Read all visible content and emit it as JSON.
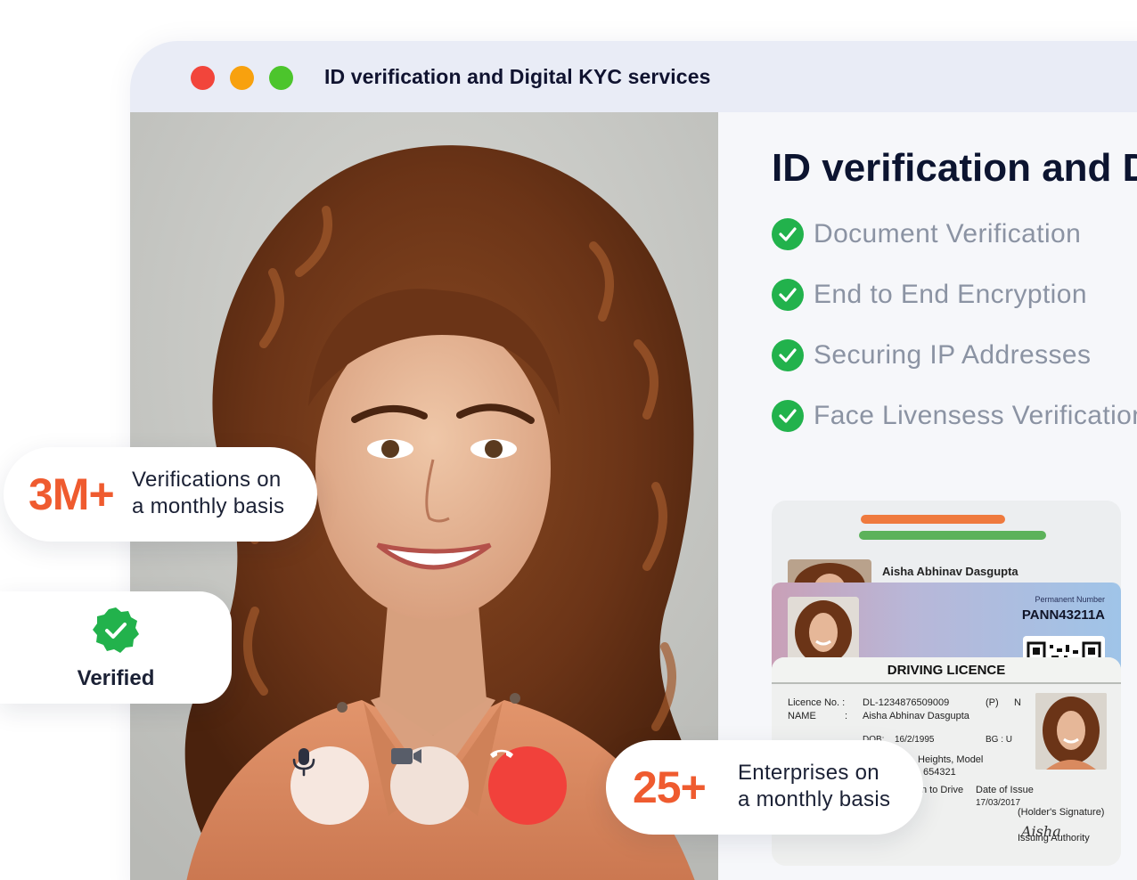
{
  "window": {
    "title": "ID verification and Digital KYC services",
    "controls": [
      "close",
      "minimize",
      "maximize"
    ]
  },
  "call_controls": {
    "mic_icon": "microphone-icon",
    "camera_icon": "video-camera-icon",
    "end_icon": "phone-hangup-icon"
  },
  "panel": {
    "heading": "ID verification and Digital KYC services",
    "features": [
      {
        "label": "Document Verification"
      },
      {
        "label": "End to End Encryption"
      },
      {
        "label": "Securing IP Addresses"
      },
      {
        "label": "Face Livensess Verification"
      }
    ]
  },
  "id_cards": {
    "top_name": "Aisha Abhinav Dasgupta",
    "pan": {
      "perm_label": "Permanent Number",
      "number": "PANN43211A"
    },
    "dl": {
      "title": "DRIVING LICENCE",
      "licence_label": "Licence No. :",
      "licence_no": "DL-1234876509009",
      "p_label": "(P)",
      "n_label": "N",
      "name_label": "NAME",
      "name_sep": ":",
      "name": "Aisha Abhinav Dasgupta",
      "dob_label": "DOB:",
      "dob": "16/2/1995",
      "bg_label": "BG : U",
      "address_1": "Heights, Model",
      "address_2": "654321",
      "drive_label": "n to Drive",
      "issue_label": "Date of Issue",
      "issue_date": "17/03/2017",
      "holder_sig": "(Holder's Signature)",
      "authority": "Issuing Authority",
      "signature": "Aisha"
    }
  },
  "stats": {
    "verifications": {
      "value": "3M+",
      "line1": "Verifications on",
      "line2": "a monthly basis"
    },
    "verified": {
      "label": "Verified"
    },
    "enterprises": {
      "value": "25+",
      "line1": "Enterprises on",
      "line2": "a monthly basis"
    }
  },
  "colors": {
    "accent_orange": "#ef5b2f",
    "check_green": "#22b24c",
    "end_call_red": "#f1413b",
    "titlebar": "#e9ecf6"
  }
}
